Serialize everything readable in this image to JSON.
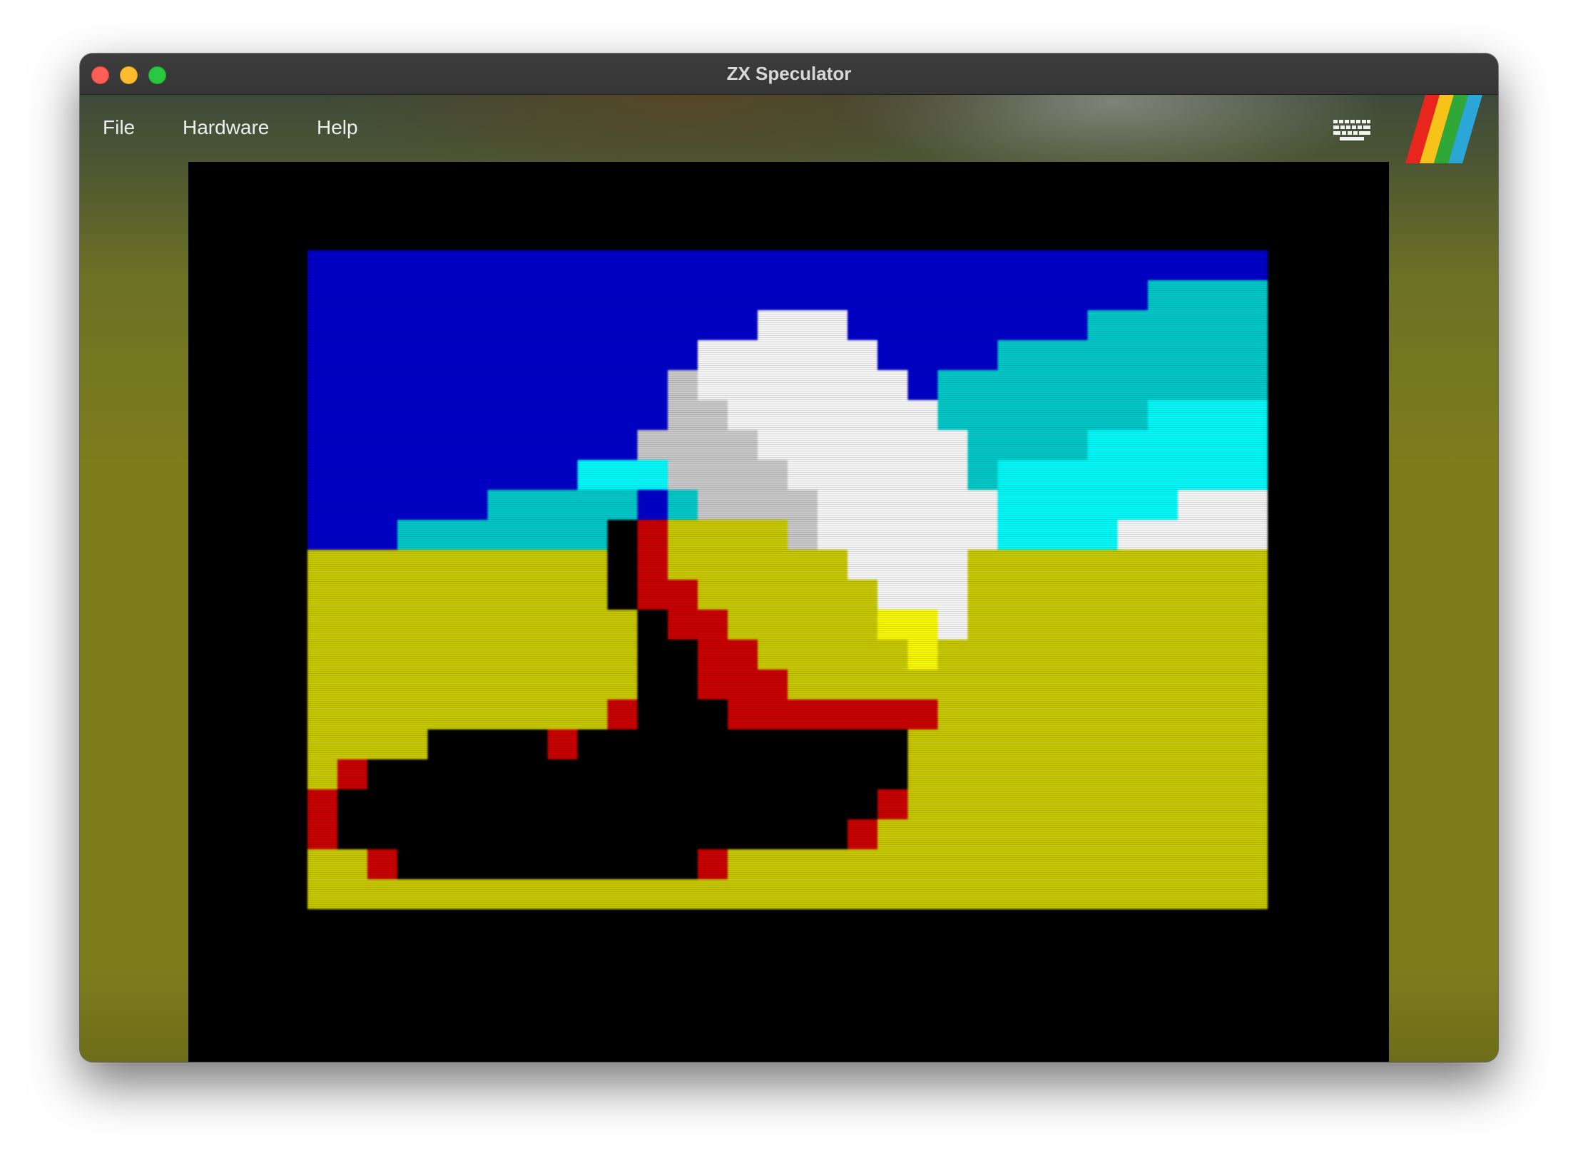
{
  "window": {
    "title": "ZX Speculator"
  },
  "menu": {
    "file": "File",
    "hardware": "Hardware",
    "help": "Help"
  },
  "icons": {
    "keyboard": "keyboard-icon",
    "logo": "zx-spectrum-rainbow-logo",
    "traffic_lights": [
      "close",
      "minimize",
      "zoom"
    ]
  },
  "colors": {
    "border": "#000000",
    "sky": "#0000c8",
    "cyan": "#00c8c8",
    "bright_cyan": "#00f8f8",
    "white": "#f5f5f5",
    "grey": "#c8c8c8",
    "ground": "#c8c800",
    "bright_yellow": "#f8f800",
    "red": "#c80000",
    "black": "#000000",
    "logo_stripes": [
      "#e8261d",
      "#f7c21a",
      "#2fa837",
      "#2aa7d6"
    ]
  },
  "screen": {
    "cols": 32,
    "rows": 22,
    "palette": {
      "B": "#0000c8",
      "C": "#00c8c8",
      "D": "#00f8f8",
      "W": "#f5f5f5",
      "G": "#c8c8c8",
      "Y": "#c8c800",
      "Z": "#f8f800",
      "R": "#c80000",
      "K": "#000000"
    },
    "bitmap": [
      "BBBBBBBBBBBBBBBBBBBBBBBBBBBBBBBB",
      "BBBBBBBBBBBBBBBBBBBBBBBBBBBBCCCC",
      "BBBBBBBBBBBBBBBWWWBBBBBBBBCCCCCC",
      "BBBBBBBBBBBBBWWWWWWBBBBCCCCCCCCC",
      "BBBBBBBBBBBBGWWWWWWWBCCCCCCCCCCC",
      "BBBBBBBBBBBBGGWWWWWWWCCCCCCCDDDD",
      "BBBBBBBBBBBGGGGWWWWWWWCCCCDDDDDD",
      "BBBBBBBBBDDDGGGGWWWWWWCDDDDDDDDD",
      "BBBBBBCCCCCBCGGGGWWWWWWDDDDDDWWW",
      "BBBCCCCCCCKRYYYYGWWWWWWDDDDWWWWW",
      "YYYYYYYYYYKRYYYYYYWWWWYYYYYYYYYY",
      "YYYYYYYYYYKRRYYYYYYWWWYYYYYYYYYY",
      "YYYYYYYYYYYKRRYYYYYZZWYYYYYYYYYY",
      "YYYYYYYYYYYKKRRYYYYYZYYYYYYYYYYY",
      "YYYYYYYYYYYKKRRRYYYYYYYYYYYYYYYY",
      "YYYYYYYYYYRKKKRRRRRRRYYYYYYYYYYY",
      "YYYYKKKKRKKKKKKKKKKKYYYYYYYYYYYY",
      "YRKKKKKKKKKKKKKKKKKKYYYYYYYYYYYY",
      "RKKKKKKKKKKKKKKKKKKRYYYYYYYYYYYY",
      "RKKKKKKKKKKKKKKKKKRYYYYYYYYYYYYY",
      "YYRKKKKKKKKKKRYYYYYYYYYYYYYYYYYY",
      "YYYYYYYYYYYYYYYYYYYYYYYYYYYYYYYY"
    ]
  }
}
